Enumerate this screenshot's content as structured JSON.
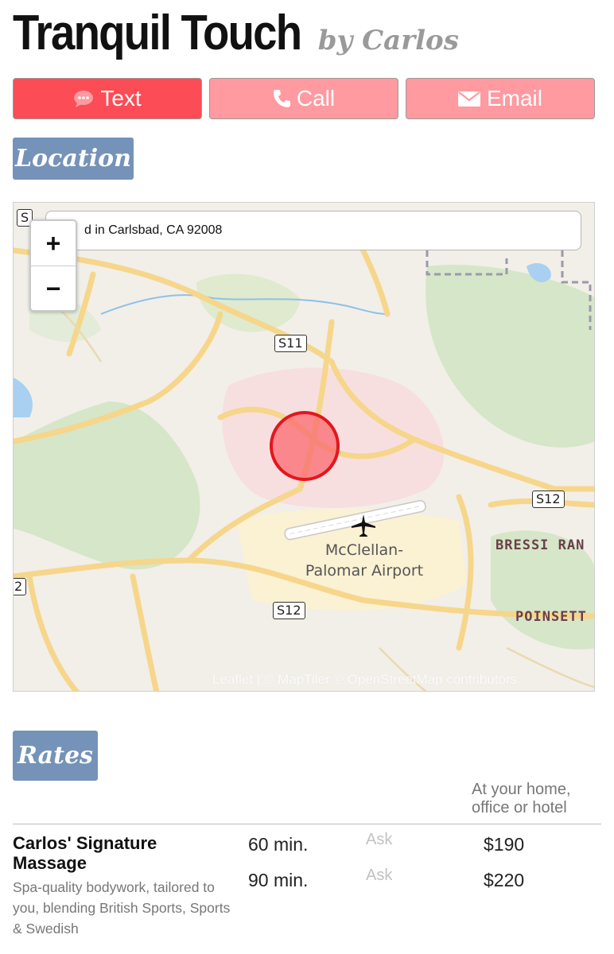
{
  "header": {
    "title": "Tranquil Touch",
    "byline": "by Carlos"
  },
  "contact": {
    "text_label": "Text",
    "call_label": "Call",
    "email_label": "Email",
    "active_color": "#fc4c55",
    "inactive_color": "#fe9aa0"
  },
  "sections": {
    "location_label": "Location",
    "rates_label": "Rates"
  },
  "map": {
    "search_text": "d in Carlsbad, CA 92008",
    "zoom_in": "+",
    "zoom_out": "−",
    "shields": [
      "S11",
      "S12",
      "S12",
      "S",
      "2"
    ],
    "airport_name_line1": "McClellan-",
    "airport_name_line2": "Palomar Airport",
    "area1": "BRESSI RAN",
    "area2": "POINSETT",
    "attribution": "Leaflet | © MapTiler © OpenStreetMap contributors"
  },
  "rates": {
    "column_header": "At your home, office or hotel",
    "service": {
      "name": "Carlos' Signature Massage",
      "description": "Spa-quality bodywork, tailored to you, blending British Sports, Sports & Swedish",
      "options": [
        {
          "duration": "60 min.",
          "ask": "Ask",
          "price": "$190"
        },
        {
          "duration": "90 min.",
          "ask": "Ask",
          "price": "$220"
        }
      ]
    }
  }
}
